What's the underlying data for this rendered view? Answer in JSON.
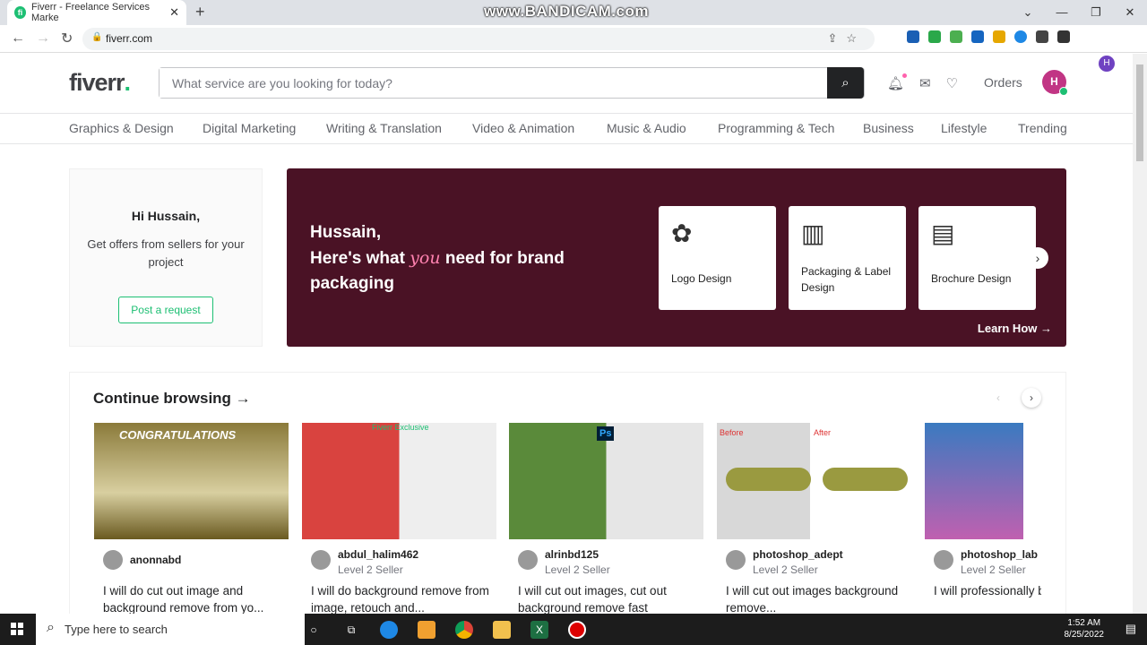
{
  "browser": {
    "tab_title": "Fiverr - Freelance Services Marke",
    "url": "fiverr.com",
    "watermark": "www.BANDICAM.com",
    "profile_initial": "H"
  },
  "header": {
    "logo": "fiverr",
    "logo_dot": ".",
    "search_placeholder": "What service are you looking for today?",
    "orders": "Orders",
    "avatar": "H"
  },
  "categories": [
    "Graphics & Design",
    "Digital Marketing",
    "Writing & Translation",
    "Video & Animation",
    "Music & Audio",
    "Programming & Tech",
    "Business",
    "Lifestyle",
    "Trending"
  ],
  "greeting": {
    "title": "Hi Hussain,",
    "text": "Get offers from sellers for your project",
    "button": "Post a request"
  },
  "banner": {
    "line1": "Hussain,",
    "line2a": "Here's what ",
    "line2b": "you",
    "line2c": " need for brand",
    "line3": "packaging",
    "cards": [
      "Logo Design",
      "Packaging & Label Design",
      "Brochure Design"
    ],
    "learn": "Learn How →"
  },
  "continue": {
    "title": "Continue browsing →",
    "gigs": [
      {
        "seller": "anonnabd",
        "level": "",
        "title": "I will do cut out image and background remove from yo...",
        "img_text": "CONGRATULATIONS"
      },
      {
        "seller": "abdul_halim462",
        "level": "Level 2 Seller",
        "title": "I will do background remove from image, retouch and...",
        "img_text": "Fiverr Exclusive"
      },
      {
        "seller": "alrinbd125",
        "level": "Level 2 Seller",
        "title": "I will cut out images, cut out background remove fast",
        "img_text": "Ps"
      },
      {
        "seller": "photoshop_adept",
        "level": "Level 2 Seller",
        "title": "I will cut out images background remove...",
        "img_text": "Before",
        "img_text2": "After"
      },
      {
        "seller": "photoshop_lab",
        "level": "Level 2 Seller",
        "title": "I will professionally background from i...",
        "img_text": ""
      }
    ]
  },
  "taskbar": {
    "search": "Type here to search",
    "time": "1:52 AM",
    "date": "8/25/2022"
  }
}
